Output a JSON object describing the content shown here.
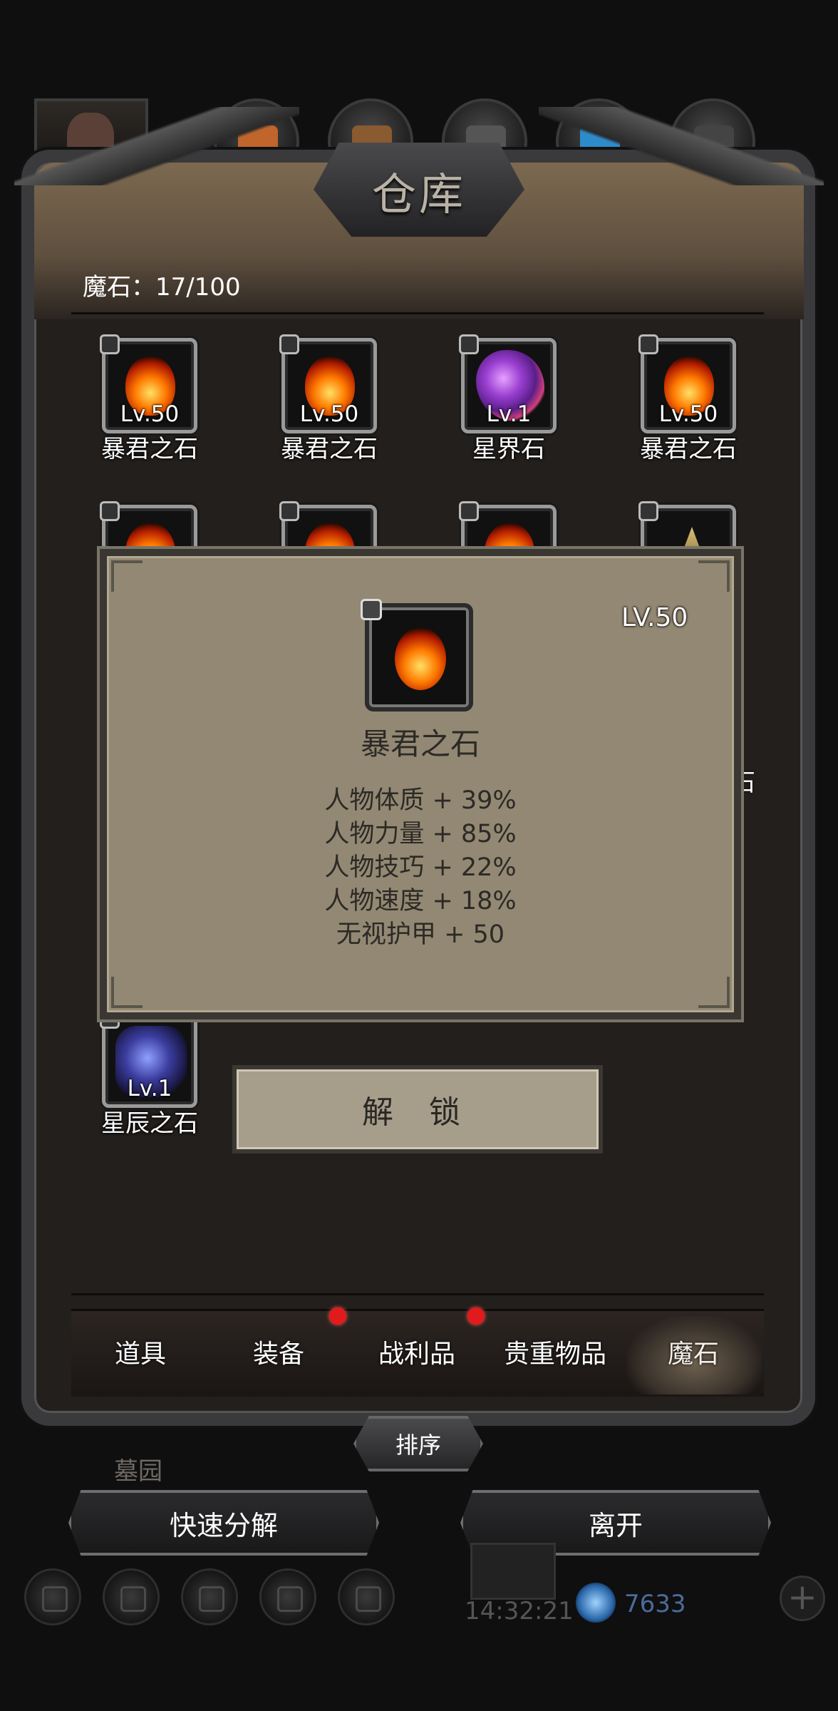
{
  "title": "仓库",
  "count_label": "魔石：17/100",
  "items": [
    {
      "level": "Lv.50",
      "name": "暴君之石",
      "icon": "fire-gem-icon"
    },
    {
      "level": "Lv.50",
      "name": "暴君之石",
      "icon": "fire-gem-icon"
    },
    {
      "level": "Lv.1",
      "name": "星界石",
      "icon": "astral-gem-icon"
    },
    {
      "level": "Lv.50",
      "name": "暴君之石",
      "icon": "fire-gem-icon"
    },
    {
      "level": "Lv.1",
      "name": "星辰之石",
      "icon": "star-gem-icon"
    }
  ],
  "partial_edge_text": "石",
  "popup": {
    "level": "LV.50",
    "name": "暴君之石",
    "stats": [
      "人物体质 + 39%",
      "人物力量 + 85%",
      "人物技巧 + 22%",
      "人物速度 + 18%",
      "无视护甲 + 50"
    ]
  },
  "unlock_button": "解 锁",
  "tabs": [
    {
      "label": "道具",
      "badge": false
    },
    {
      "label": "装备",
      "badge": true
    },
    {
      "label": "战利品",
      "badge": true
    },
    {
      "label": "贵重物品",
      "badge": false
    },
    {
      "label": "魔石",
      "badge": false,
      "active": true
    }
  ],
  "sort_button": "排序",
  "area_label": "墓园",
  "quick_decompose_button": "快速分解",
  "leave_button": "离开",
  "hud": {
    "time": "14:32:21",
    "currency": "7633"
  },
  "colors": {
    "badge": "#e11b1b",
    "popup_bg": "#938873",
    "panel_bg": "#231f1c"
  }
}
